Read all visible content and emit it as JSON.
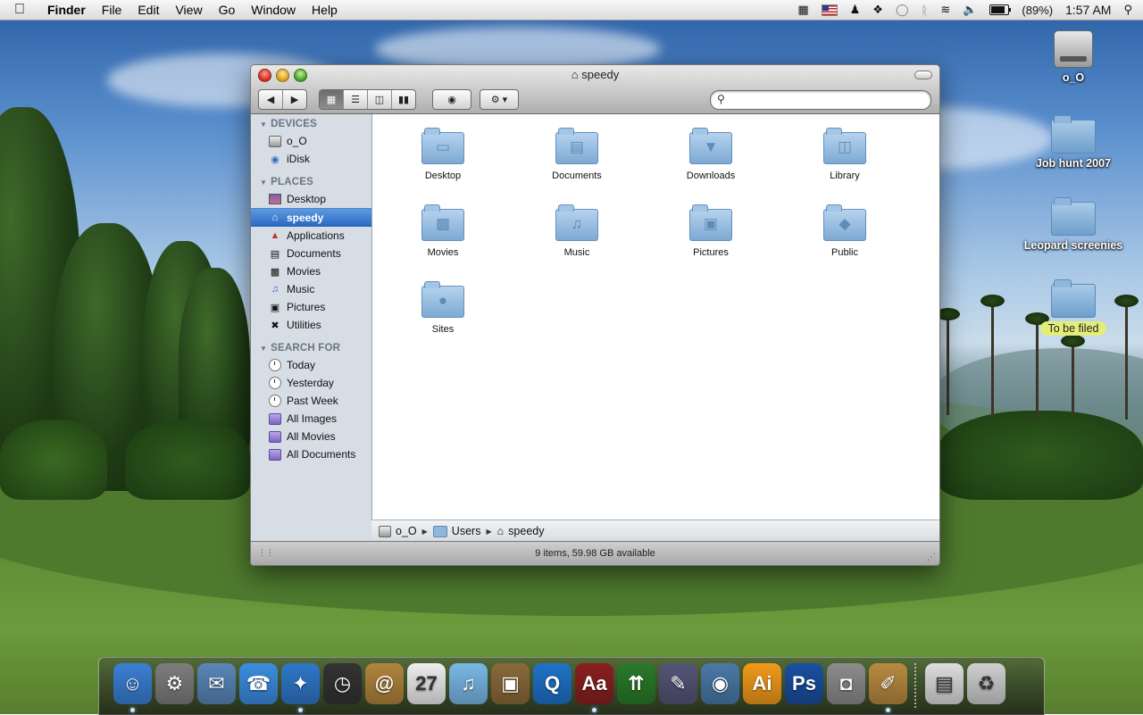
{
  "menubar": {
    "apple_icon": "apple-logo-icon",
    "app_name": "Finder",
    "menus": [
      "File",
      "Edit",
      "View",
      "Go",
      "Window",
      "Help"
    ],
    "status": {
      "icons": [
        "spaces-icon",
        "us-flag-input-icon",
        "user-icon",
        "script-icon",
        "ichat-bubble-icon",
        "bluetooth-icon",
        "wifi-icon",
        "volume-icon"
      ],
      "battery_label": "(89%)",
      "battery_level": 0.89,
      "clock": "1:57 AM"
    }
  },
  "desktop_icons": [
    {
      "label": "o_O",
      "kind": "hard-drive"
    },
    {
      "label": "Job hunt 2007",
      "kind": "folder"
    },
    {
      "label": "Leopard screenies",
      "kind": "folder"
    },
    {
      "label": "To be filed",
      "kind": "folder",
      "label_color": "#e3ee7a"
    }
  ],
  "window": {
    "title": "speedy",
    "toolbar": {
      "view_modes": [
        "icon-view",
        "list-view",
        "column-view",
        "coverflow-view"
      ],
      "active_view": "icon-view",
      "search_placeholder": ""
    },
    "sidebar": {
      "sections": [
        {
          "title": "DEVICES",
          "items": [
            {
              "label": "o_O",
              "icon": "hard-drive-icon"
            },
            {
              "label": "iDisk",
              "icon": "idisk-icon"
            }
          ]
        },
        {
          "title": "PLACES",
          "items": [
            {
              "label": "Desktop",
              "icon": "desktop-icon"
            },
            {
              "label": "speedy",
              "icon": "home-icon",
              "selected": true
            },
            {
              "label": "Applications",
              "icon": "applications-icon"
            },
            {
              "label": "Documents",
              "icon": "documents-icon"
            },
            {
              "label": "Movies",
              "icon": "movies-icon"
            },
            {
              "label": "Music",
              "icon": "music-icon"
            },
            {
              "label": "Pictures",
              "icon": "pictures-icon"
            },
            {
              "label": "Utilities",
              "icon": "utilities-icon"
            }
          ]
        },
        {
          "title": "SEARCH FOR",
          "items": [
            {
              "label": "Today",
              "icon": "clock-icon"
            },
            {
              "label": "Yesterday",
              "icon": "clock-icon"
            },
            {
              "label": "Past Week",
              "icon": "clock-icon"
            },
            {
              "label": "All Images",
              "icon": "smart-folder-icon"
            },
            {
              "label": "All Movies",
              "icon": "smart-folder-icon"
            },
            {
              "label": "All Documents",
              "icon": "smart-folder-icon"
            }
          ]
        }
      ]
    },
    "items": [
      {
        "label": "Desktop",
        "icon": "desktop-folder-icon"
      },
      {
        "label": "Documents",
        "icon": "documents-folder-icon"
      },
      {
        "label": "Downloads",
        "icon": "downloads-folder-icon"
      },
      {
        "label": "Library",
        "icon": "library-folder-icon"
      },
      {
        "label": "Movies",
        "icon": "movies-folder-icon"
      },
      {
        "label": "Music",
        "icon": "music-folder-icon"
      },
      {
        "label": "Pictures",
        "icon": "pictures-folder-icon"
      },
      {
        "label": "Public",
        "icon": "public-folder-icon"
      },
      {
        "label": "Sites",
        "icon": "sites-folder-icon"
      }
    ],
    "path": [
      "o_O",
      "Users",
      "speedy"
    ],
    "status": "9 items, 59.98 GB available"
  },
  "dock": {
    "apps": [
      {
        "name": "finder-icon",
        "running": true,
        "color": "#3b7fd4",
        "glyph": "☺"
      },
      {
        "name": "system-preferences-icon",
        "running": false,
        "color": "#7d7d7d",
        "glyph": "⚙"
      },
      {
        "name": "mail-icon",
        "running": false,
        "color": "#5a86b9",
        "glyph": "✉"
      },
      {
        "name": "ichat-icon",
        "running": false,
        "color": "#3c8de0",
        "glyph": "☎"
      },
      {
        "name": "safari-icon",
        "running": true,
        "color": "#2f78c8",
        "glyph": "✦"
      },
      {
        "name": "time-machine-icon",
        "running": false,
        "color": "#333333",
        "glyph": "◷"
      },
      {
        "name": "address-book-icon",
        "running": false,
        "color": "#b0843e",
        "glyph": "@"
      },
      {
        "name": "ical-icon",
        "running": false,
        "color": "#eeeeee",
        "glyph": "27"
      },
      {
        "name": "itunes-icon",
        "running": false,
        "color": "#7ab8e6",
        "glyph": "♫"
      },
      {
        "name": "iphoto-icon",
        "running": false,
        "color": "#8a6a3a",
        "glyph": "▣"
      },
      {
        "name": "quicktime-icon",
        "running": false,
        "color": "#1e73c8",
        "glyph": "Q"
      },
      {
        "name": "dictionary-icon",
        "running": true,
        "color": "#8a2020",
        "glyph": "Aa"
      },
      {
        "name": "activity-monitor-icon",
        "running": false,
        "color": "#2a7a2a",
        "glyph": "⇈"
      },
      {
        "name": "script-editor-icon",
        "running": false,
        "color": "#555577",
        "glyph": "✎"
      },
      {
        "name": "preview-icon",
        "running": false,
        "color": "#4a7aa8",
        "glyph": "◉"
      },
      {
        "name": "illustrator-icon",
        "running": false,
        "color": "#f29a1a",
        "glyph": "Ai"
      },
      {
        "name": "photoshop-icon",
        "running": false,
        "color": "#1a4fa0",
        "glyph": "Ps"
      },
      {
        "name": "image-capture-icon",
        "running": false,
        "color": "#8c8c8c",
        "glyph": "◘"
      },
      {
        "name": "keynote-icon",
        "running": true,
        "color": "#b88a40",
        "glyph": "✐"
      }
    ],
    "stacks": [
      {
        "name": "documents-stack-icon",
        "color": "#dddddd",
        "glyph": "▤"
      },
      {
        "name": "trash-icon",
        "color": "#cfcfcf",
        "glyph": "♻"
      }
    ]
  }
}
